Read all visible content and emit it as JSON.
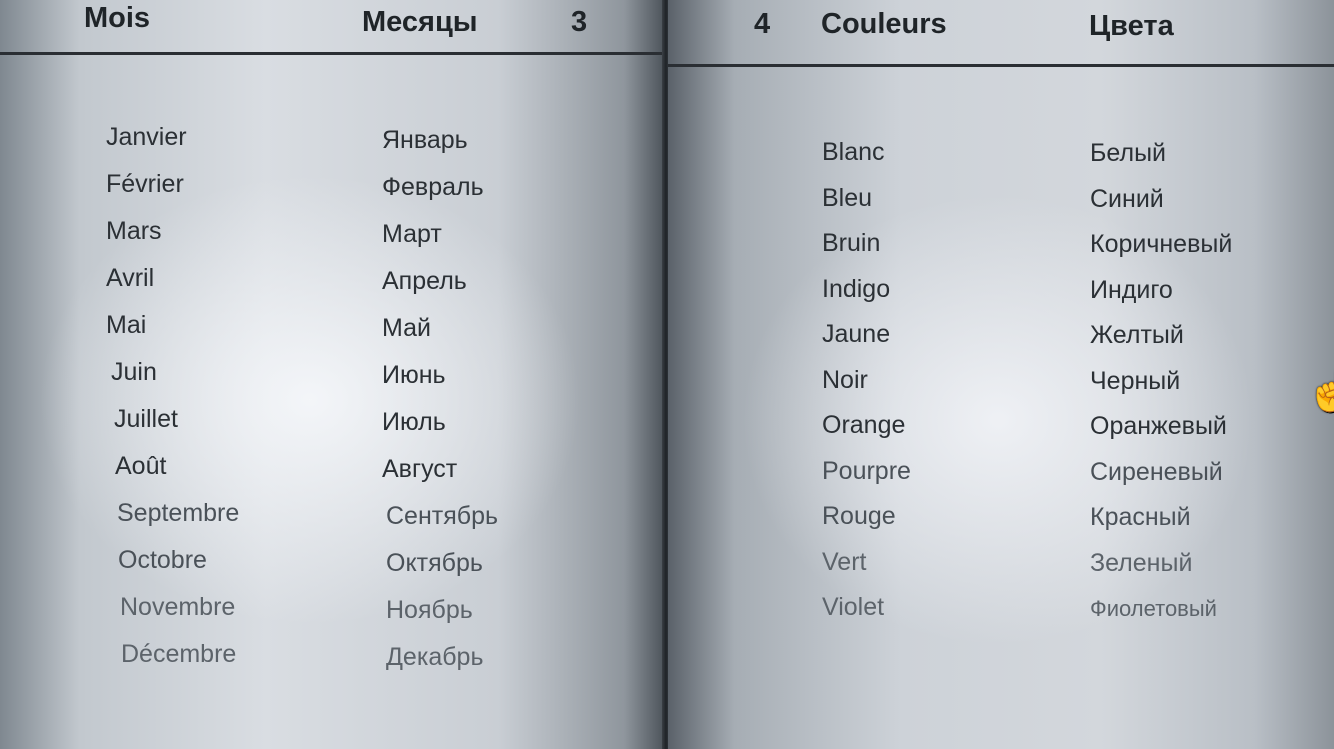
{
  "left_page": {
    "header": {
      "title_fr": "Mois",
      "title_ru": "Месяцы",
      "page_number": "3"
    },
    "months_fr": [
      "Janvier",
      "Février",
      "Mars",
      "Avril",
      "Mai",
      "Juin",
      "Juillet",
      "Août",
      "Septembre",
      "Octobre",
      "Novembre",
      "Décembre"
    ],
    "months_ru": [
      "Январь",
      "Февраль",
      "Март",
      "Апрель",
      "Май",
      "Июнь",
      "Июль",
      "Август",
      "Сентябрь",
      "Октябрь",
      "Ноябрь",
      "Декабрь"
    ]
  },
  "right_page": {
    "header": {
      "page_number": "4",
      "title_fr": "Couleurs",
      "title_ru": "Цвета"
    },
    "colors_fr": [
      "Blanc",
      "Bleu",
      "Bruin",
      "Indigo",
      "Jaune",
      "Noir",
      "Orange",
      "Pourpre",
      "Rouge",
      "Vert",
      "Violet"
    ],
    "colors_ru": [
      "Белый",
      "Синий",
      "Коричневый",
      "Индиго",
      "Желтый",
      "Черный",
      "Оранжевый",
      "Сиреневый",
      "Красный",
      "Зеленый",
      "Фиолетовый"
    ]
  },
  "icons": {
    "cursor": "hand-pointer-icon"
  }
}
